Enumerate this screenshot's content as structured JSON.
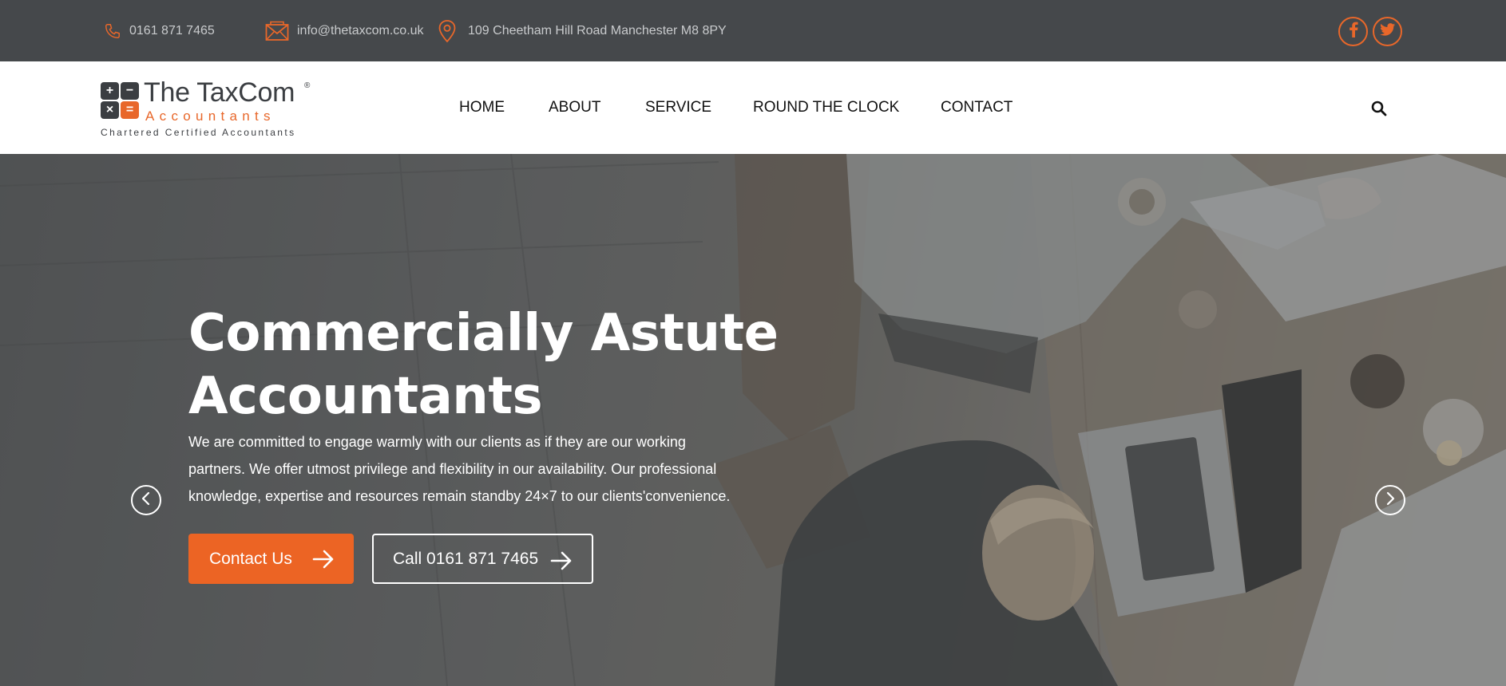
{
  "topbar": {
    "phone": "0161 871 7465",
    "email": "info@thetaxcom.co.uk",
    "address": "109 Cheetham Hill Road Manchester M8 8PY",
    "social": [
      {
        "name": "facebook-icon",
        "glyph": "f"
      },
      {
        "name": "twitter-icon",
        "glyph": "t"
      }
    ]
  },
  "logo": {
    "name": "The TaxCom",
    "reg": "®",
    "sub": "Accountants",
    "tagline": "Chartered Certified Accountants",
    "cells": [
      "+",
      "−",
      "×",
      "="
    ]
  },
  "nav": {
    "items": [
      "HOME",
      "ABOUT",
      "SERVICE",
      "ROUND THE CLOCK",
      "CONTACT"
    ]
  },
  "hero": {
    "title_line1": "Commercially Astute",
    "title_line2": "Accountants",
    "desc_line1": "We are committed to engage warmly with our clients as if they are our working",
    "desc_line2": "partners. We offer utmost privilege and flexibility in our availability. Our professional",
    "desc_line3": "knowledge, expertise and resources remain standby 24×7 to our clients'convenience.",
    "primary_button": "Contact Us",
    "secondary_button": "Call 0161 871 7465"
  },
  "colors": {
    "accent": "#ec6424",
    "topbar_bg": "#45484b",
    "text_dark": "#111111"
  }
}
